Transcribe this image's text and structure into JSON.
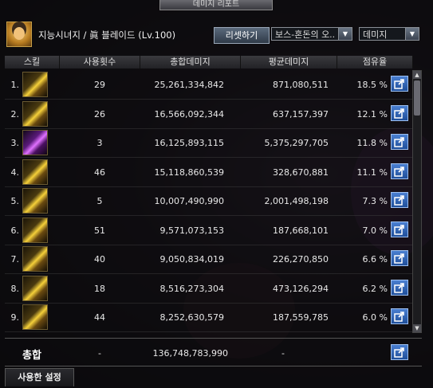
{
  "window": {
    "title": "데미지 리포트"
  },
  "header": {
    "character_info": "지능시녀지 / 眞 블레이드 (Lv.100)",
    "reset_label": "리셋하기",
    "dungeon_select": "보스-혼돈의 오..",
    "metric_select": "데미지"
  },
  "columns": {
    "skill": "스킬",
    "count": "사용횟수",
    "total": "총합데미지",
    "avg": "평균데미지",
    "share": "점유율"
  },
  "rows": [
    {
      "idx": "1.",
      "count": "29",
      "total": "25,261,334,842",
      "avg": "871,080,511",
      "share": "18.5 %"
    },
    {
      "idx": "2.",
      "count": "26",
      "total": "16,566,092,344",
      "avg": "637,157,397",
      "share": "12.1 %"
    },
    {
      "idx": "3.",
      "count": "3",
      "total": "16,125,893,115",
      "avg": "5,375,297,705",
      "share": "11.8 %"
    },
    {
      "idx": "4.",
      "count": "46",
      "total": "15,118,860,539",
      "avg": "328,670,881",
      "share": "11.1 %"
    },
    {
      "idx": "5.",
      "count": "5",
      "total": "10,007,490,990",
      "avg": "2,001,498,198",
      "share": "7.3 %"
    },
    {
      "idx": "6.",
      "count": "51",
      "total": "9,571,073,153",
      "avg": "187,668,101",
      "share": "7.0 %"
    },
    {
      "idx": "7.",
      "count": "40",
      "total": "9,050,834,019",
      "avg": "226,270,850",
      "share": "6.6 %"
    },
    {
      "idx": "8.",
      "count": "18",
      "total": "8,516,273,304",
      "avg": "473,126,294",
      "share": "6.2 %"
    },
    {
      "idx": "9.",
      "count": "44",
      "total": "8,252,630,579",
      "avg": "187,559,785",
      "share": "6.0 %"
    }
  ],
  "summary": {
    "label": "총합",
    "count": "-",
    "total": "136,748,783,990",
    "avg": "-"
  },
  "settings_tab": "사용한 설정",
  "icons": {
    "share": "share-icon",
    "dropdown": "chevron-down-icon"
  },
  "colors": {
    "accent": "#2f63b8",
    "gold": "#f5d03a"
  }
}
